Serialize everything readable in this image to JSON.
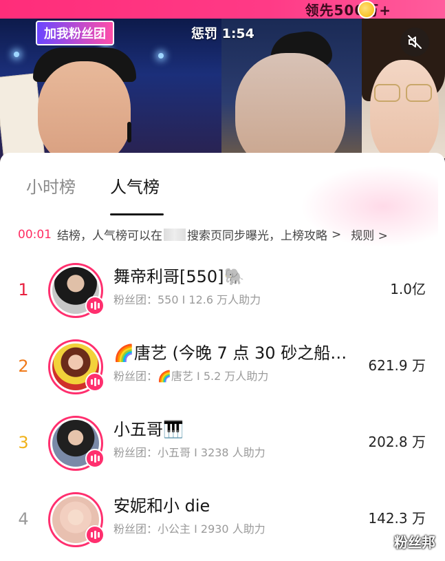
{
  "stream": {
    "banner_text": "领先500万+",
    "fan_badge": "加我粉丝团",
    "punish_timer": "惩罚 1:54",
    "mute_icon": "mute-icon"
  },
  "panel": {
    "tabs": [
      {
        "label": "小时榜",
        "active": false
      },
      {
        "label": "人气榜",
        "active": true
      }
    ],
    "notice": {
      "time": "00:01",
      "text_before": "结榜，人气榜可以在",
      "text_after": "搜索页同步曝光，上榜攻略",
      "link_arrow": ">",
      "rules": "规则 >"
    },
    "rankings": [
      {
        "rank": "1",
        "rank_color": "#e8203f",
        "name": "舞帝利哥[550]🐘",
        "fan_group": "粉丝团：550 I 12.6 万人助力",
        "score": "1.0亿"
      },
      {
        "rank": "2",
        "rank_color": "#f07a1a",
        "name": "🌈唐艺 (今晚 7 点 30 砂之船…",
        "fan_group": "粉丝团：🌈唐艺 I 5.2 万人助力",
        "score": "621.9 万"
      },
      {
        "rank": "3",
        "rank_color": "#f0b21a",
        "name": "小五哥🎹",
        "fan_group": "粉丝团：小五哥 I 3238 人助力",
        "score": "202.8 万"
      },
      {
        "rank": "4",
        "rank_color": "#9a9a9a",
        "name": "安妮和小 die",
        "fan_group": "粉丝团：小公主 I 2930 人助力",
        "score": "142.3 万"
      }
    ]
  },
  "watermark": "粉丝邦"
}
